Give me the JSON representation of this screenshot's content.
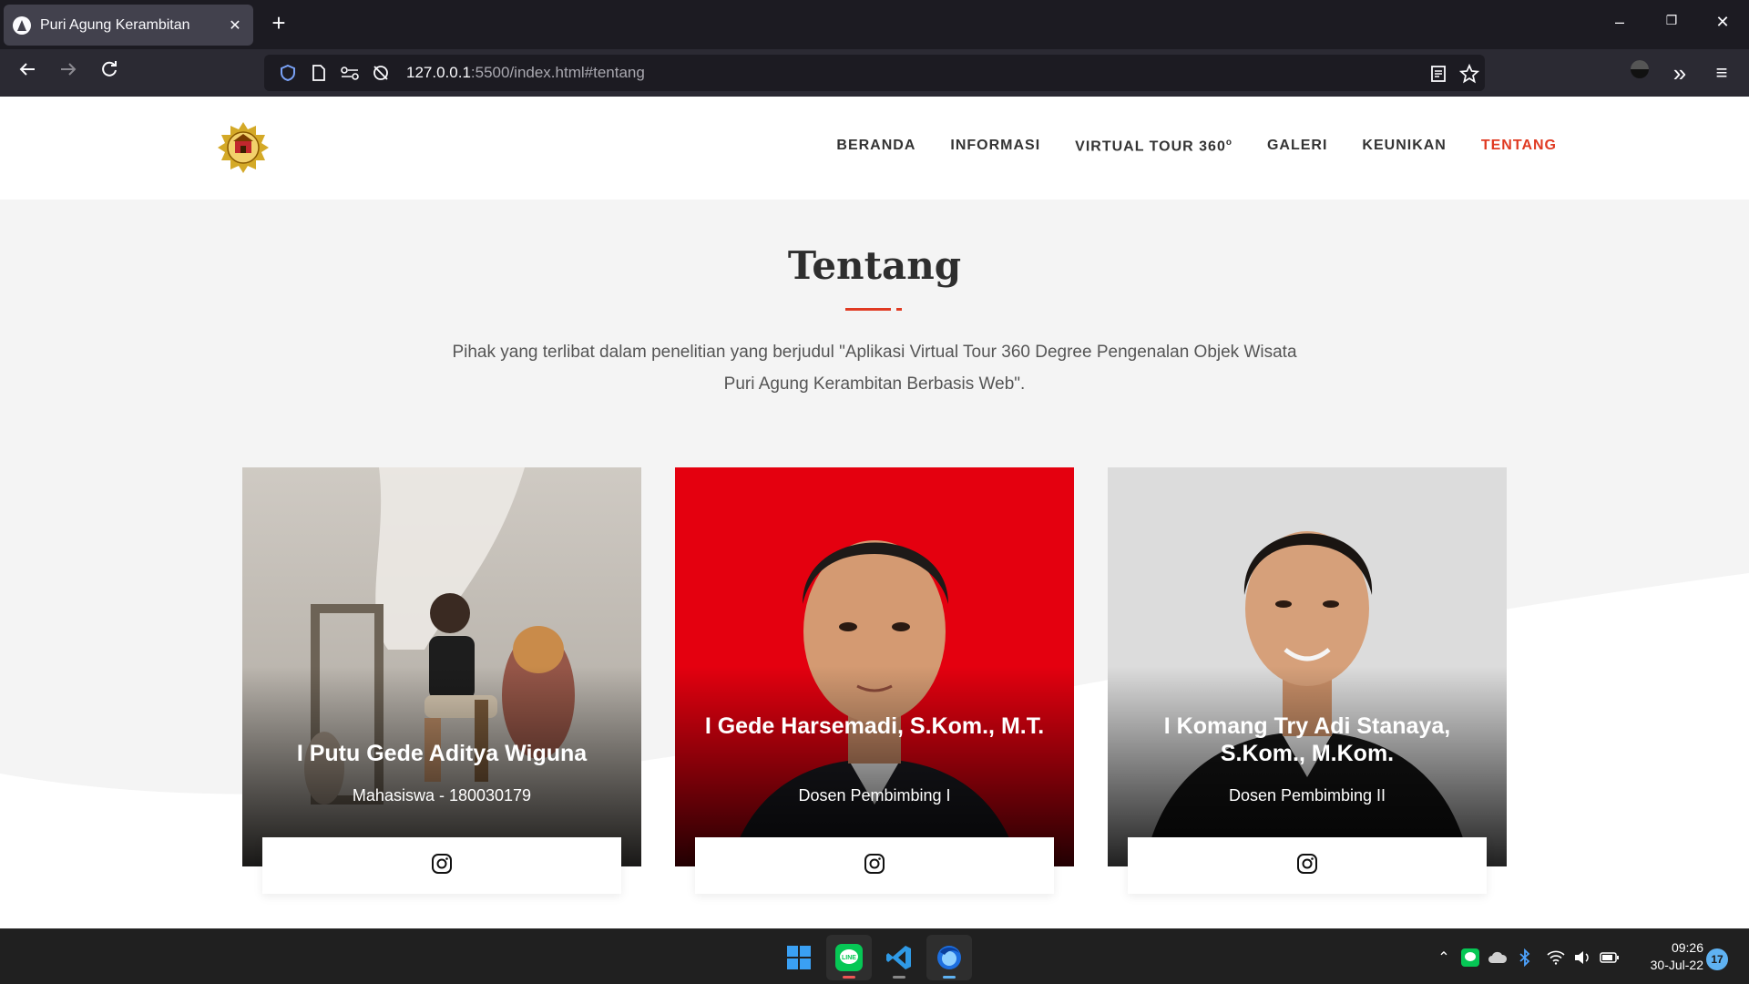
{
  "browser": {
    "tab_title": "Puri Agung Kerambitan",
    "url_host": "127.0.0.1",
    "url_rest": ":5500/index.html#tentang"
  },
  "site": {
    "menu": [
      {
        "label": "BERANDA"
      },
      {
        "label": "INFORMASI"
      },
      {
        "label": "VIRTUAL TOUR 360"
      },
      {
        "label": "GALERI"
      },
      {
        "label": "KEUNIKAN"
      },
      {
        "label": "TENTANG"
      }
    ],
    "menu_degree_sup": "o",
    "active_menu": "TENTANG",
    "accent_color": "#e03a22"
  },
  "section": {
    "title": "Tentang",
    "description": "Pihak yang terlibat dalam penelitian yang berjudul \"Aplikasi Virtual Tour 360 Degree Pengenalan Objek Wisata Puri Agung Kerambitan Berbasis Web\"."
  },
  "team": [
    {
      "name": "I Putu Gede Aditya Wiguna",
      "role": "Mahasiswa - 180030179",
      "social_icon": "instagram-icon"
    },
    {
      "name": "I Gede Harsemadi, S.Kom., M.T.",
      "role": "Dosen Pembimbing I",
      "social_icon": "instagram-icon"
    },
    {
      "name": "I Komang Try Adi Stanaya, S.Kom., M.Kom.",
      "role": "Dosen Pembimbing II",
      "social_icon": "instagram-icon"
    }
  ],
  "taskbar": {
    "time": "09:26",
    "date": "30-Jul-22",
    "notification_count": "17",
    "apps": [
      "start-icon",
      "line-icon",
      "vscode-icon",
      "firefox-icon"
    ]
  }
}
